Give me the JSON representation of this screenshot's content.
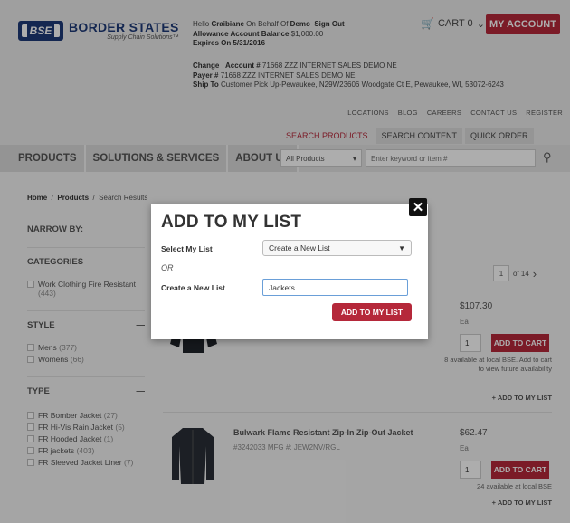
{
  "header": {
    "logo_mark": "BSE",
    "logo_name": "BORDER STATES",
    "logo_tag": "Supply Chain Solutions™",
    "hello_prefix": "Hello",
    "user": "Craibiane",
    "behalf_prefix": "On Behalf Of",
    "behalf_of": "Demo",
    "sign_out": "Sign Out",
    "allowance_label": "Allowance Account Balance",
    "allowance_value": "$1,000.00",
    "expires_label": "Expires On",
    "expires_value": "5/31/2016",
    "cart_label": "CART 0",
    "my_account": "MY ACCOUNT",
    "change": "Change",
    "account_label": "Account #",
    "account_value": "71668 ZZZ INTERNET SALES DEMO NE",
    "payer_label": "Payer #",
    "payer_value": "71668 ZZZ INTERNET SALES DEMO NE",
    "shipto_label": "Ship To",
    "shipto_value": "Customer Pick Up-Pewaukee, N29W23606 Woodgate Ct E, Pewaukee, WI, 53072-6243"
  },
  "util_links": [
    "LOCATIONS",
    "BLOG",
    "CAREERS",
    "CONTACT US",
    "REGISTER"
  ],
  "subnav": [
    "SEARCH PRODUCTS",
    "SEARCH CONTENT",
    "QUICK ORDER"
  ],
  "mainnav": [
    "PRODUCTS",
    "SOLUTIONS & SERVICES",
    "ABOUT US"
  ],
  "search": {
    "category": "All Products",
    "placeholder": "Enter keyword or item #"
  },
  "breadcrumb": {
    "home": "Home",
    "products": "Products",
    "results": "Search Results"
  },
  "sidebar": {
    "narrow_by": "NARROW BY:",
    "categories": "CATEGORIES",
    "cat_items": [
      {
        "label": "Work Clothing Fire Resistant",
        "count": "(443)"
      }
    ],
    "style": "STYLE",
    "style_items": [
      {
        "label": "Mens",
        "count": "(377)"
      },
      {
        "label": "Womens",
        "count": "(66)"
      }
    ],
    "type": "TYPE",
    "type_items": [
      {
        "label": "FR Bomber Jacket",
        "count": "(27)"
      },
      {
        "label": "FR Hi-Vis Rain Jacket",
        "count": "(5)"
      },
      {
        "label": "FR Hooded Jacket",
        "count": "(1)"
      },
      {
        "label": "FR jackets",
        "count": "(403)"
      },
      {
        "label": "FR Sleeved Jacket Liner",
        "count": "(7)"
      }
    ]
  },
  "pager": {
    "page": "1",
    "of": "of 14"
  },
  "products": [
    {
      "name": "",
      "sku": "",
      "price": "$107.30",
      "unit": "Ea",
      "qty": "1",
      "add_to_cart": "ADD TO CART",
      "availability": "8 available at local BSE. Add to cart to view future availability",
      "add_to_list": "+ ADD TO MY LIST"
    },
    {
      "name": "Bulwark Flame Resistant Zip-In Zip-Out Jacket",
      "sku": "#3242033 MFG #: JEW2NV/RGL",
      "price": "$62.47",
      "unit": "Ea",
      "qty": "1",
      "add_to_cart": "ADD TO CART",
      "availability": "24 available at local BSE",
      "add_to_list": "+ ADD TO MY LIST"
    }
  ],
  "modal": {
    "title": "ADD TO MY LIST",
    "select_label": "Select My List",
    "select_value": "Create a New List",
    "or": "OR",
    "create_label": "Create a New List",
    "create_value": "Jackets",
    "submit": "ADD TO MY LIST"
  },
  "colors": {
    "brand_red": "#b5283a",
    "brand_blue": "#1e3a78"
  }
}
